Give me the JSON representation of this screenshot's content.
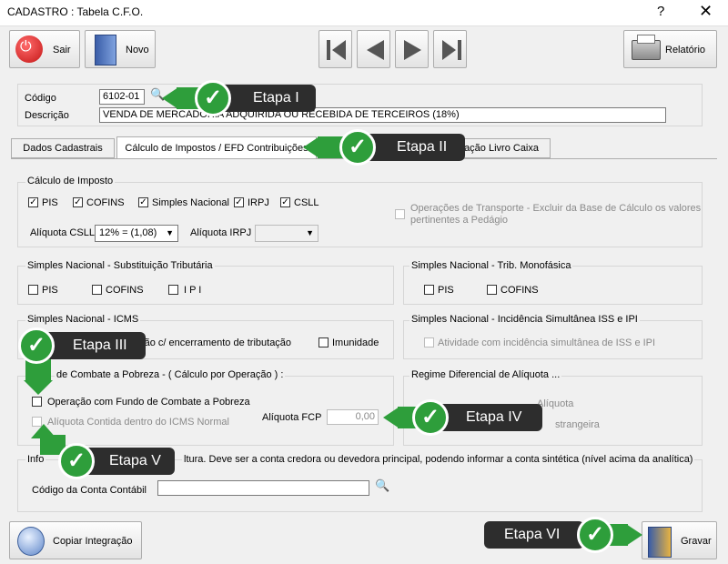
{
  "window": {
    "title": "CADASTRO : Tabela C.F.O.",
    "help": "?",
    "close": "✕"
  },
  "toolbar": {
    "sair": "Sair",
    "novo": "Novo",
    "relatorio": "Relatório"
  },
  "form": {
    "codigo_label": "Código",
    "codigo_value": "6102-01",
    "descricao_label": "Descrição",
    "descricao_value": "VENDA DE MERCADORIA ADQUIRIDA OU RECEBIDA DE TERCEIROS (18%)"
  },
  "tabs": [
    "Dados Cadastrais",
    "Cálculo de Impostos / EFD Contribuições",
    "Integração Livro Caixa"
  ],
  "calculo": {
    "title": "Cálculo de Imposto",
    "pis": "PIS",
    "cofins": "COFINS",
    "simples": "Simples Nacional",
    "irpj": "IRPJ",
    "csll": "CSLL",
    "transporte": "Operações de Transporte - Excluir da Base de Cálculo os valores pertinentes a Pedágio",
    "aliquota_csll_label": "Alíquota CSLL",
    "aliquota_csll_value": "12% = (1,08)",
    "aliquota_irpj_label": "Alíquota IRPJ"
  },
  "sn_st": {
    "title": "Simples Nacional - Substituição Tributária",
    "pis": "PIS",
    "cofins": "COFINS",
    "ipi": "I P I"
  },
  "sn_mono": {
    "title": "Simples Nacional - Trib. Monofásica",
    "pis": "PIS",
    "cofins": "COFINS"
  },
  "sn_icms": {
    "title": "Simples Nacional - ICMS",
    "op_text": "ação c/ encerramento de tributação",
    "imunidade": "Imunidade"
  },
  "sn_iss": {
    "title": "Simples Nacional - Incidência Simultânea ISS e IPI",
    "atividade": "Atividade com incidência simultânea de ISS e IPI"
  },
  "fcp": {
    "title": "de Combate a Pobreza - ( Cálculo por Operação ) :",
    "operacao": "Operação com Fundo de Combate a Pobreza",
    "aliquota_contida": "Alíquota Contida dentro do ICMS Normal",
    "aliquota_fcp_label": "Alíquota FCP",
    "aliquota_fcp_value": "0,00"
  },
  "regime": {
    "title": "Regime Diferencial de Alíquota ...",
    "item1": "Alíquota",
    "item2": "strangeira"
  },
  "integracao": {
    "text": "ltura. Deve ser a conta credora ou devedora principal, podendo informar a conta sintética (nível acima da analítica)",
    "prefix": "Info",
    "conta_label": "Código da Conta Contábil"
  },
  "bottom": {
    "copiar": "Copiar Integração",
    "gravar": "Gravar"
  },
  "callouts": {
    "e1": "Etapa I",
    "e2": "Etapa II",
    "e3": "Etapa III",
    "e4": "Etapa IV",
    "e5": "Etapa V",
    "e6": "Etapa VI"
  },
  "colors": {
    "accent_green": "#2e9e3b",
    "callout_bg": "#2d2d2d"
  }
}
